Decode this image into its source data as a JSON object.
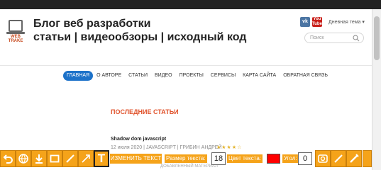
{
  "header": {
    "logo_text": "WEB\nTRAKE",
    "title": "Блог веб разработки",
    "subtitle": "статьи | видеообзоры | исходный код",
    "vk_label": "vk",
    "yt_label": "You\nTube",
    "theme_label": "Дневная тема ▾",
    "search_placeholder": "Поиск"
  },
  "nav": {
    "items": [
      "ГЛАВНАЯ",
      "О АВТОРЕ",
      "СТАТЬИ",
      "ВИДЕО",
      "ПРОЕКТЫ",
      "СЕРВИСЫ",
      "КАРТА САЙТА",
      "ОБРАТНАЯ СВЯЗЬ"
    ],
    "active_index": 0,
    "active_color": "#1d72c9"
  },
  "main": {
    "section_title": "ПОСЛЕДНИЕ СТАТЬИ",
    "post": {
      "title": "Shadow dom javascript",
      "meta": "12 июля 2020 | JAVASCRIPT | ГРИБИН АНДРЕЙ",
      "stars": "★★★★☆",
      "extra": "ДОБАВЛЕННЫЙ МАТЕРИАЛ"
    }
  },
  "toolbar": {
    "edit_text_label": "ИЗМЕНИТЬ ТЕКСТ",
    "size_label": "Размер текста:",
    "size_value": "18",
    "color_label": "Цвет текста:",
    "color_value": "#ff0000",
    "angle_label": "Угол:",
    "angle_value": "0",
    "accent_color": "#f5a31a",
    "buttons": [
      "undo-icon",
      "globe-icon",
      "download-icon",
      "rectangle-icon",
      "line-icon",
      "arrow-icon",
      "text-icon",
      "image-icon",
      "pen-icon"
    ]
  }
}
